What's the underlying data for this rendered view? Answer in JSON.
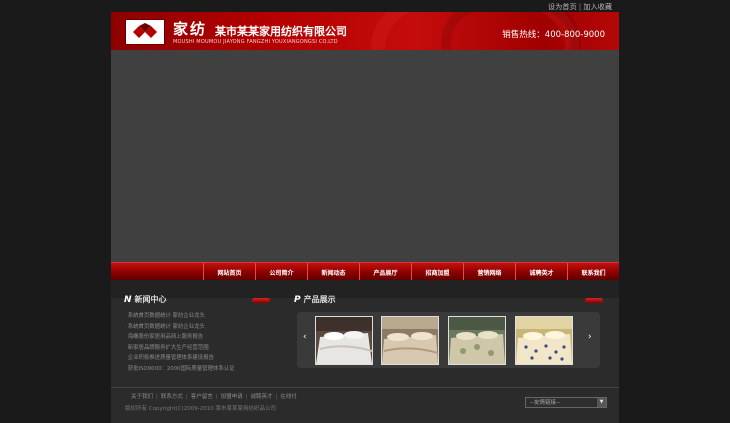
{
  "top_links": {
    "home": "设为首页",
    "fav": "加入收藏"
  },
  "header": {
    "brand_cn": "家纺",
    "company_cn": "某市某某家用纺织有限公司",
    "company_en": "MOUSHI MOUMOU JIAYONG FANGZHI YOUXIANGONGSI CO.LTD",
    "hotline": "销售热线：400-800-9000"
  },
  "nav": [
    "网站首页",
    "公司简介",
    "新闻动态",
    "产品展厅",
    "招商加盟",
    "营销网络",
    "诚聘英才",
    "联系我们"
  ],
  "news": {
    "title": "新闻中心",
    "title_icon": "N",
    "items": [
      "系统首页数据统计 家纺企业龙头",
      "系统首页数据统计 家纺企业龙头",
      "海螺股份家居用品网上服务报告",
      "新家居品牌服务扩大生产经营范围",
      "企业积极推进质量管理体系建设报告",
      "获批ISO9000：2000国际质量管理体系认证"
    ]
  },
  "products": {
    "title": "产品展示",
    "title_icon": "P",
    "prev": "‹",
    "next": "›",
    "thumbs": [
      {
        "name": "bedding-white",
        "bed": "#e8e6e2",
        "pillow": "#ffffff",
        "wall": "#5a4a40",
        "pattern": "#c9c2b8"
      },
      {
        "name": "bedding-beige",
        "bed": "#d8c8b0",
        "pillow": "#efe3cf",
        "wall": "#8a7a66",
        "pattern": "#b69a78"
      },
      {
        "name": "bedding-floral",
        "bed": "#cfc7a8",
        "pillow": "#e8e2c8",
        "wall": "#6b7a5e",
        "pattern": "#8f9a70"
      },
      {
        "name": "bedding-dots",
        "bed": "#f1e7c8",
        "pillow": "#fff6dc",
        "wall": "#c9b47a",
        "pattern": "#3b4b8a"
      }
    ]
  },
  "footer": {
    "links": [
      "关于我们",
      "联系方式",
      "客户留言",
      "加盟申请",
      "诚聘英才",
      "在线付"
    ],
    "copyright": "版权所有 Copyright(C)2009-2010 某市某某家用纺织品公司",
    "friend_select": "--友情链接--"
  },
  "colors": {
    "brand_red": "#b30000",
    "bg": "#1a1a1a",
    "panel": "#2b2b2b",
    "banner": "#404040"
  }
}
